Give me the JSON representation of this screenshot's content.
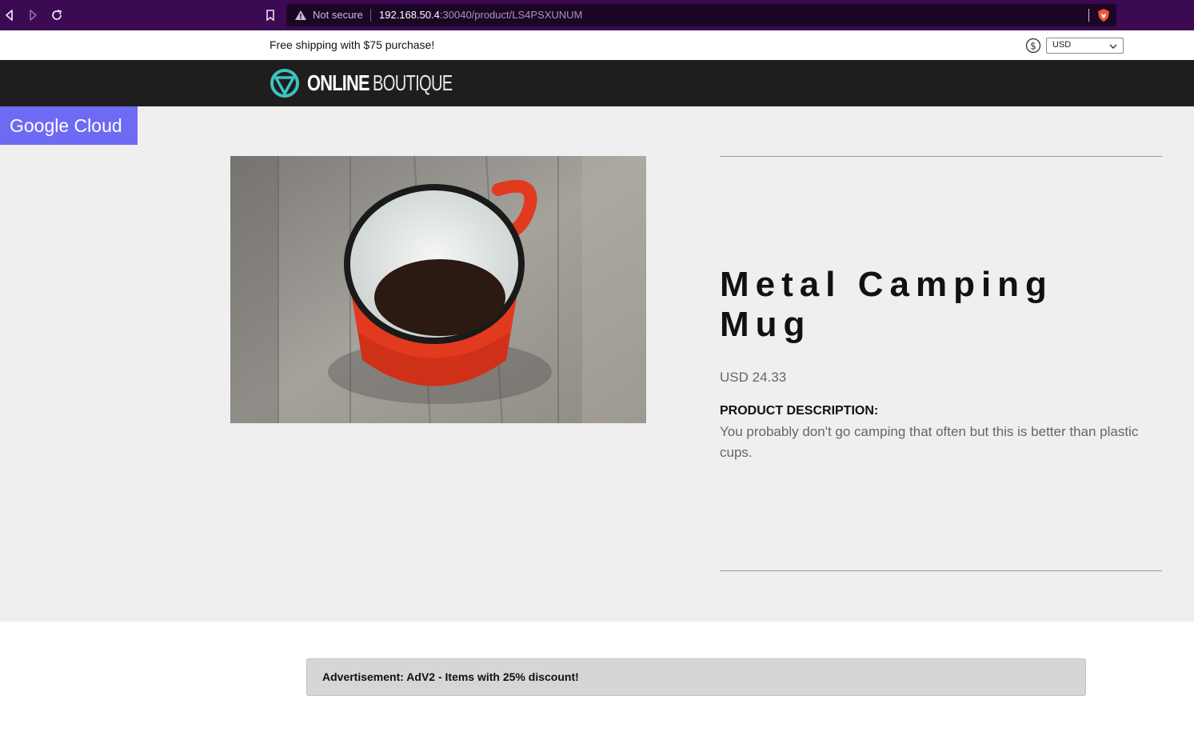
{
  "browser": {
    "security_label": "Not secure",
    "url_host": "192.168.50.4",
    "url_path": ":30040/product/LS4PSXUNUM",
    "icons": [
      "back-icon",
      "forward-icon",
      "reload-icon",
      "bookmark-icon",
      "warning-icon",
      "brave-shield-icon"
    ]
  },
  "banner": {
    "shipping_text": "Free shipping with $75 purchase!",
    "currency": "USD",
    "currency_icon": "dollar-circle-icon"
  },
  "header": {
    "logo_bold": "ONLINE",
    "logo_light": "BOUTIQUE"
  },
  "badge": {
    "label": "Google Cloud"
  },
  "product": {
    "title": "Metal Camping Mug",
    "price": "USD 24.33",
    "description_label": "PRODUCT DESCRIPTION:",
    "description": "You probably don't go camping that often but this is better than plastic cups.",
    "image_alt": "red enamel mug on wooden table"
  },
  "ad": {
    "text": "Advertisement: AdV2 - Items with 25% discount!"
  },
  "colors": {
    "browser_bar": "#3b0a52",
    "header_bg": "#1e1e1e",
    "main_bg": "#efefef",
    "badge_bg": "#6f6af3",
    "logo_accent": "#3cc3c0",
    "mug_red": "#e23a1f"
  }
}
